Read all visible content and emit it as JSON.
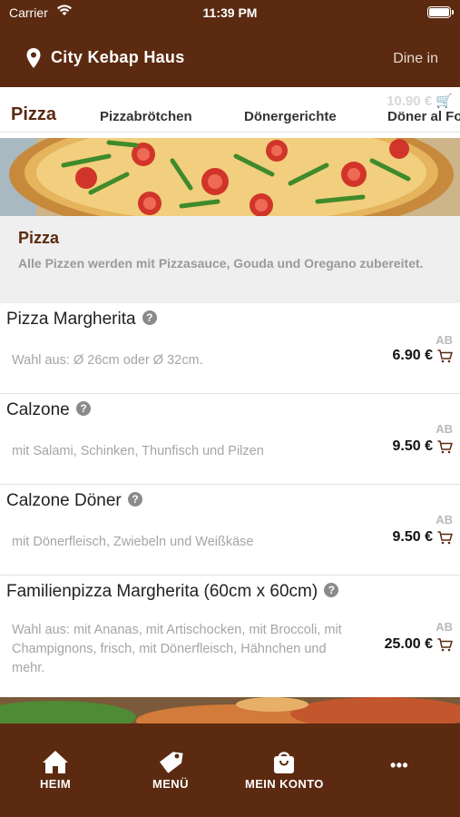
{
  "status_bar": {
    "carrier": "Carrier",
    "time": "11:39 PM"
  },
  "header": {
    "shop_name": "City Kebap Haus",
    "mode": "Dine in"
  },
  "tabs": [
    {
      "label": "Pizza",
      "active": true
    },
    {
      "label": "Pizzabrötchen"
    },
    {
      "label": "Dönergerichte"
    },
    {
      "label": "Döner al Fo"
    }
  ],
  "tabs_ghost_price": "10.90 € 🛒",
  "category": {
    "title": "Pizza",
    "description": "Alle Pizzen werden mit Pizzasauce, Gouda und Oregano zubereitet."
  },
  "items": [
    {
      "name": "Pizza Margherita",
      "description": "Wahl aus: Ø 26cm oder Ø 32cm.",
      "ab": "AB",
      "price": "6.90 €"
    },
    {
      "name": "Calzone",
      "description": "mit Salami, Schinken, Thunfisch und Pilzen",
      "ab": "AB",
      "price": "9.50 €"
    },
    {
      "name": "Calzone Döner",
      "description": "mit Dönerfleisch, Zwiebeln und Weißkäse",
      "ab": "AB",
      "price": "9.50 €"
    },
    {
      "name": "Familienpizza Margherita (60cm x 60cm)",
      "description": "Wahl aus: mit Ananas, mit Artischocken, mit Broccoli, mit Champignons, frisch, mit Dönerfleisch, Hähnchen und mehr.",
      "ab": "AB",
      "price": "25.00 €"
    }
  ],
  "help_glyph": "?",
  "tabbar": {
    "home": "HEIM",
    "menu": "MENÜ",
    "account": "MEIN KONTO",
    "more": "•••"
  },
  "colors": {
    "brand": "#5b2a10",
    "background": "#ffffff",
    "category_bg": "#efefef",
    "muted_text": "#a5a5a5"
  },
  "icons": [
    "wifi-icon",
    "battery-icon",
    "location-pin-icon",
    "cart-icon",
    "help-icon",
    "home-icon",
    "tag-icon",
    "shopping-bag-icon",
    "more-icon"
  ]
}
